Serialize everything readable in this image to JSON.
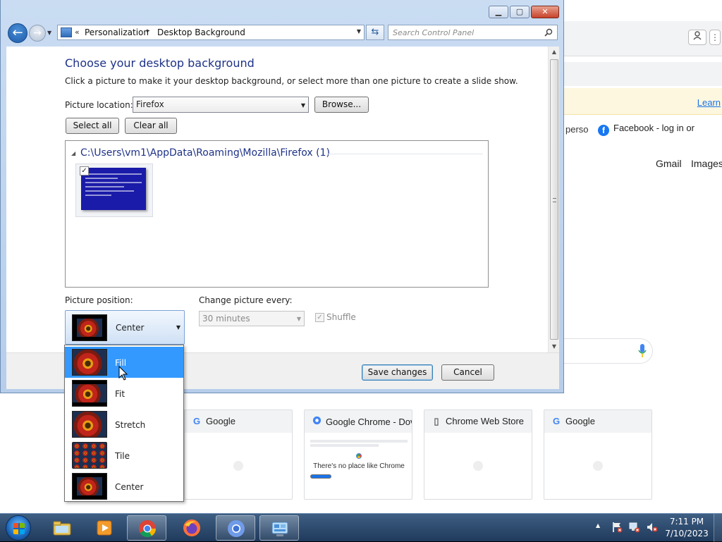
{
  "control_panel": {
    "breadcrumb": {
      "root_glyph": "«",
      "items": [
        "Personalization",
        "Desktop Background"
      ],
      "separator": "▸"
    },
    "search": {
      "placeholder": "Search Control Panel"
    },
    "title": "Choose your desktop background",
    "subtitle": "Click a picture to make it your desktop background, or select more than one picture to create a slide show.",
    "picture_location": {
      "label": "Picture location:",
      "value": "Firefox"
    },
    "buttons": {
      "browse": "Browse...",
      "select_all": "Select all",
      "clear_all": "Clear all",
      "save": "Save changes",
      "cancel": "Cancel"
    },
    "picture_group": {
      "path": "C:\\Users\\vm1\\AppData\\Roaming\\Mozilla\\Firefox (1)",
      "checked": true
    },
    "picture_position": {
      "label": "Picture position:",
      "value": "Center",
      "options": [
        "Fill",
        "Fit",
        "Stretch",
        "Tile",
        "Center"
      ],
      "highlighted": "Fill"
    },
    "change_every": {
      "label": "Change picture every:",
      "value": "30 minutes"
    },
    "shuffle": {
      "label": "Shuffle",
      "checked": true,
      "enabled": false
    }
  },
  "chrome_background": {
    "learn_link": "Learn",
    "bookmarks": [
      "perso",
      "Facebook - log in or"
    ],
    "top_links": [
      "Gmail",
      "Images"
    ],
    "shortcuts": [
      {
        "title": "Google",
        "icon": "google-g-icon"
      },
      {
        "title": "Google Chrome - Dov",
        "icon": "chrome-icon",
        "preview_text": "There's no place like Chrome"
      },
      {
        "title": "Chrome Web Store",
        "icon": "page-icon"
      },
      {
        "title": "Google",
        "icon": "google-g-icon"
      }
    ]
  },
  "taskbar": {
    "items": [
      "explorer",
      "media-player",
      "chrome",
      "firefox",
      "chromium",
      "control-panel"
    ],
    "time": "7:11 PM",
    "date": "7/10/2023"
  },
  "colors": {
    "title_blue": "#1e3287",
    "selection": "#3399ff",
    "thumb_blue": "#1a1ba8",
    "taskbar": "#1f3a5c"
  }
}
